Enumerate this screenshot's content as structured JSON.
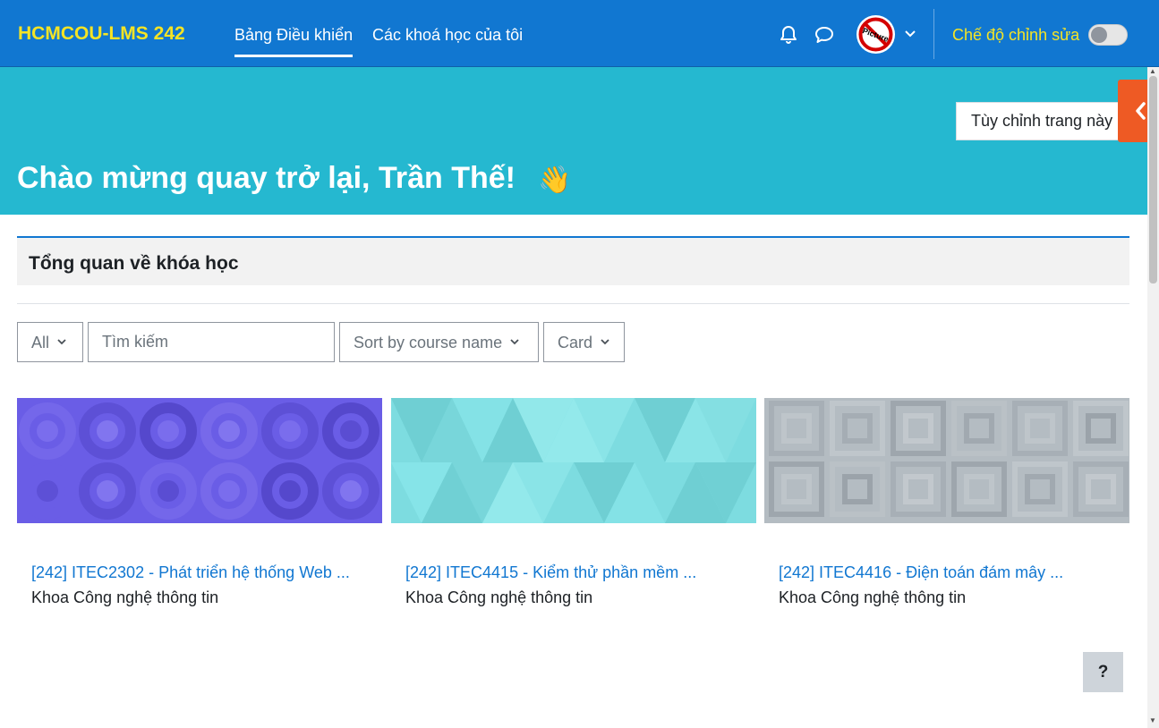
{
  "navbar": {
    "brand": "HCMCOU-LMS 242",
    "links": [
      {
        "label": "Bảng Điều khiển",
        "active": true
      },
      {
        "label": "Các khoá học của tôi",
        "active": false
      }
    ],
    "avatar_text": "Picture",
    "edit_mode_label": "Chế độ chỉnh sửa",
    "edit_mode_on": false,
    "brand_color": "#f5e425",
    "bg_color": "#1177d1"
  },
  "header": {
    "customize_label": "Tùy chỉnh trang này",
    "welcome": "Chào mừng quay trở lại, Trần Thế!",
    "wave_emoji": "👋",
    "bg_color": "#25b8d0",
    "drawer_color": "#ee5a24"
  },
  "course_overview": {
    "title": "Tổng quan về khóa học",
    "filter_label": "All",
    "search_placeholder": "Tìm kiếm",
    "sort_label": "Sort by course name",
    "view_label": "Card",
    "courses": [
      {
        "name": "[242] ITEC2302 - Phát triển hệ thống Web ...",
        "category": "Khoa Công nghệ thông tin",
        "pattern": "circles",
        "color": "#6a5de6"
      },
      {
        "name": "[242] ITEC4415 - Kiểm thử phần mềm ...",
        "category": "Khoa Công nghệ thông tin",
        "pattern": "triangles",
        "color": "#7ddce0"
      },
      {
        "name": "[242] ITEC4416 - Điện toán đám mây ...",
        "category": "Khoa Công nghệ thông tin",
        "pattern": "squares",
        "color": "#b4bcc2"
      }
    ]
  },
  "help_label": "?"
}
